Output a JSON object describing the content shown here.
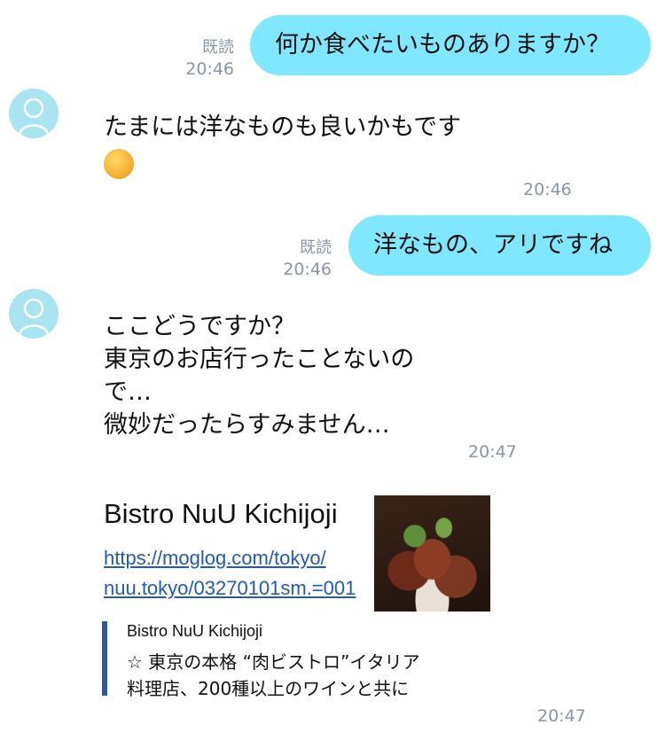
{
  "messages": [
    {
      "type": "outgoing",
      "text": "何か食べたいものありますか？",
      "read": "既読",
      "time": "20:46"
    },
    {
      "type": "incoming",
      "text": "たまには洋なものも良いかもです",
      "emoji": "smiling-face-emoji",
      "time": "20:46"
    },
    {
      "type": "outgoing",
      "text": "洋なもの、アリですね",
      "read": "既読",
      "time": "20:46"
    },
    {
      "type": "incoming",
      "text": "ここどうですか？\n東京のお店行ったことないの\nで…\n微妙だったらすみません…",
      "time": "20:47"
    }
  ],
  "link_card": {
    "title": "Bistro NuU Kichijoji",
    "url": "https://moglog.com/tokyo/\nnuu.tokyo/03270101sm.=001",
    "image": "steak-dish-photo",
    "preview_site": "Bistro NuU Kichijoji",
    "preview_text": "☆ 東京の本格 “肉ビストロ”イタリア\n  料理店、200種以上のワインと共に",
    "time": "20:47"
  },
  "colors": {
    "bubble_out": "#7fe7ff",
    "meta": "#8a96a6",
    "link": "#2058c8",
    "quote_bar": "#2f55a8",
    "avatar": "#a9e4f2"
  }
}
